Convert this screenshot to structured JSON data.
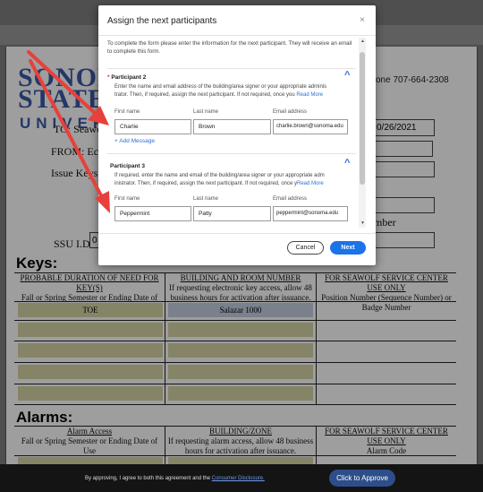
{
  "document": {
    "logo_line1": "SONOM",
    "logo_line2": "STATE",
    "logo_line3": "UNIVERS",
    "phone": "one 707-664-2308",
    "date": "0/26/2021",
    "to_label": "TO:",
    "to_value": "Seawo",
    "from_label": "FROM:",
    "from_value": "Echo",
    "issue_keys_label": "Issue Keys T",
    "number_label": "mber",
    "ssu_id_label": "SSU I.D.",
    "ssu_id_value": "0"
  },
  "keys": {
    "title": "Keys:",
    "col1_head": "PROBABLE DURATION OF NEED FOR KEY(S)",
    "col1_sub": "Fall or Spring Semester or Ending Date of Use",
    "col2_head": "BUILDING AND ROOM NUMBER",
    "col2_sub": "If requesting electronic key access, allow 48 business hours for activation after issuance.",
    "col3_head": "FOR SEAWOLF SERVICE CENTER USE ONLY",
    "col3_sub": "Position Number (Sequence Number) or Badge Number",
    "row1_col1": "TOE",
    "row1_col2": "Salazar 1000"
  },
  "alarms": {
    "title": "Alarms:",
    "col1_head": "Alarm Access",
    "col1_sub": "Fall or Spring Semester or Ending Date of Use",
    "col2_head": "BUILDING/ZONE",
    "col2_sub": "If requesting alarm access, allow 48 business hours for activation after issuance.",
    "col3_head": "FOR SEAWOLF SERVICE CENTER USE ONLY",
    "col3_sub": "Alarm Code"
  },
  "banner": {
    "text_prefix": "By approving, I agree to both this agreement and the ",
    "link": "Consumer Disclosure.",
    "approve_label": "Click to Approve"
  },
  "modal": {
    "title": "Assign the next participants",
    "close": "×",
    "intro": "To complete the form please enter the information for the next participant. They will receive an email to complete this form.",
    "participants": [
      {
        "required_mark": "*",
        "title": "Participant 2",
        "desc_line1": "Enter the name and email address of the building/area signer or your appropriate adminis",
        "desc_line2": "trator. Then, if required, assign the next participant. If not required, once you ",
        "read_more": "Read More",
        "first_label": "First name",
        "last_label": "Last name",
        "email_label": "Email address",
        "first": "Charlie",
        "last": "Brown",
        "email": "charlie.brown@sonoma.edu",
        "add_message": "+ Add Message"
      },
      {
        "title": "Participant 3",
        "desc_line1": "If required, enter the name and email of the building/area signer or your appropriate adm",
        "desc_line2": "inistrator. Then, if required, assign the next participant. If not required, once y",
        "read_more": "Read More",
        "first_label": "First name",
        "last_label": "Last name",
        "email_label": "Email address",
        "first": "Peppermint",
        "last": "Patty",
        "email": "peppermint@sonoma.edu"
      }
    ],
    "cancel_label": "Cancel",
    "next_label": "Next"
  },
  "colors": {
    "accent": "#1b73e8",
    "annotation_arrow": "#e8403b",
    "logo_blue": "#3c5aa8",
    "approve_button": "#2d4e8a"
  },
  "icons": {
    "close": "close-icon",
    "collapse": "chevron-up-icon",
    "annotation": "red-arrow"
  }
}
